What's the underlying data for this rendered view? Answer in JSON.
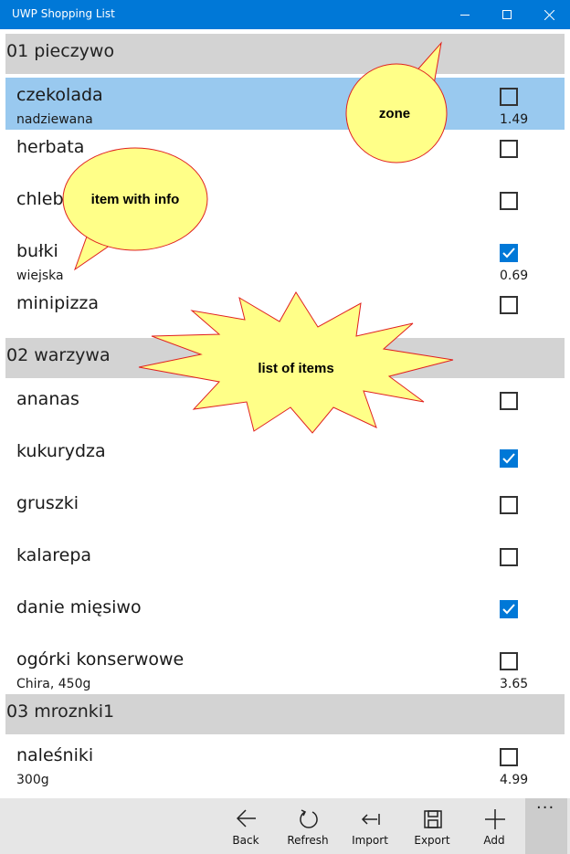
{
  "window": {
    "title": "UWP Shopping List"
  },
  "groups": [
    {
      "name": "01 pieczywo"
    },
    {
      "name": "02 warzywa"
    },
    {
      "name": "03 mroznki1"
    }
  ],
  "items": [
    {
      "name": "czekolada",
      "info": "nadziewana",
      "price": "1.49",
      "checked": false,
      "selected": true
    },
    {
      "name": "herbata",
      "info": "",
      "price": "",
      "checked": false
    },
    {
      "name": "chleb",
      "info": "",
      "price": "",
      "checked": false
    },
    {
      "name": "bułki",
      "info": "wiejska",
      "price": "0.69",
      "checked": true
    },
    {
      "name": "minipizza",
      "info": "",
      "price": "",
      "checked": false
    },
    {
      "name": "ananas",
      "info": "",
      "price": "",
      "checked": false
    },
    {
      "name": "kukurydza",
      "info": "",
      "price": "",
      "checked": true
    },
    {
      "name": "gruszki",
      "info": "",
      "price": "",
      "checked": false
    },
    {
      "name": "kalarepa",
      "info": "",
      "price": "",
      "checked": false
    },
    {
      "name": "danie mięsiwo",
      "info": "",
      "price": "",
      "checked": true
    },
    {
      "name": "ogórki konserwowe",
      "info": "Chira, 450g",
      "price": "3.65",
      "checked": false
    },
    {
      "name": "naleśniki",
      "info": "300g",
      "price": "4.99",
      "checked": false
    }
  ],
  "appbar": {
    "back": "Back",
    "refresh": "Refresh",
    "import": "Import",
    "export": "Export",
    "add": "Add",
    "more": "···"
  },
  "callouts": {
    "zone": "zone",
    "item_info": "item with info",
    "list_items": "list of items"
  },
  "colors": {
    "accent": "#0078d7",
    "selection": "#99c9ef",
    "group_header": "#d3d3d3",
    "callout_fill": "#ffff88",
    "callout_stroke": "#e02020"
  }
}
